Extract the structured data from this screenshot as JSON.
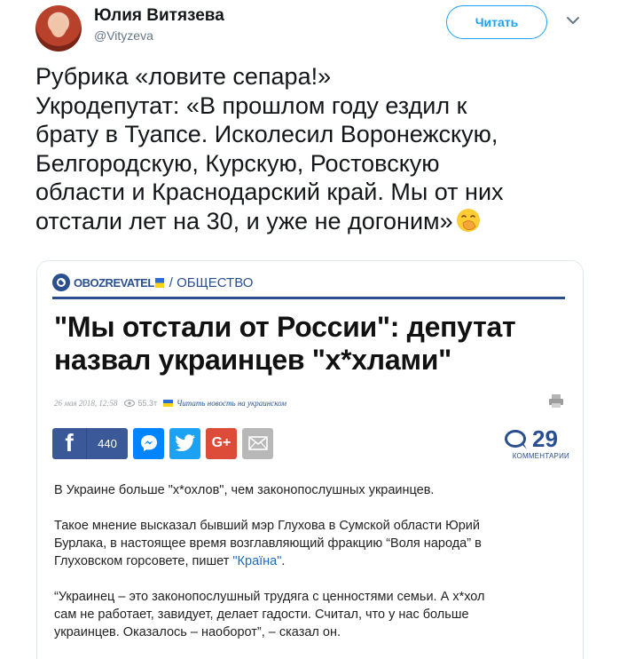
{
  "tweet": {
    "author": {
      "display_name": "Юлия Витязева",
      "handle": "@Vityzeva"
    },
    "follow_label": "Читать",
    "text_lines": [
      "Рубрика «ловите сепара!»",
      "Укродепутат: «В прошлом году ездил к",
      "брату в Туапсе. Исколесил Воронежскую,",
      "Белгородскую, Курскую, Ростовскую",
      "области и Краснодарский край. Мы от них",
      "отстали лет на 30, и уже не догоним»"
    ],
    "trailing_emoji": "face-with-hand-over-mouth"
  },
  "article": {
    "source_logo": "OBOZREVATEL",
    "section": "/ ОБЩЕСТВО",
    "headline_lines": [
      "\"Мы отстали от России\": депутат",
      "назвал украинцев \"х*хлами\""
    ],
    "meta": {
      "date": "26 мая 2018, 12:58",
      "views": "55.3т",
      "ukr_link": "Читать новость на украинском"
    },
    "share": {
      "facebook_count": "440",
      "facebook_letter": "f",
      "googleplus_label": "G+"
    },
    "comments": {
      "count": "29",
      "label": "КОММЕНТАРИИ"
    },
    "paragraph1": "В Украине больше \"х*охлов\", чем законопослушных украинцев.",
    "paragraph2": {
      "line1": "Такое мнение высказал бывший мэр Глухова в Сумской области Юрий",
      "line2": "Бурлака, в настоящее время возглавляющий фракцию “Воля народа” в",
      "line3_before": "Глуховском горсовете, пишет ",
      "line3_link": "\"Країна\"",
      "line3_after": "."
    },
    "paragraph3_lines": [
      "“Украинец – это законопослушный трудяга с ценностями семьи. А х*хол",
      "сам не работает, завидует, делает гадости. Считал, что у нас больше",
      "украинцев. Оказалось – наоборот”, – сказал он."
    ]
  },
  "colors": {
    "twitter_blue": "#1da1f2",
    "brand_navy": "#2a4f8f",
    "facebook": "#3b5998",
    "messenger": "#0084ff",
    "googleplus": "#dd4b39"
  }
}
